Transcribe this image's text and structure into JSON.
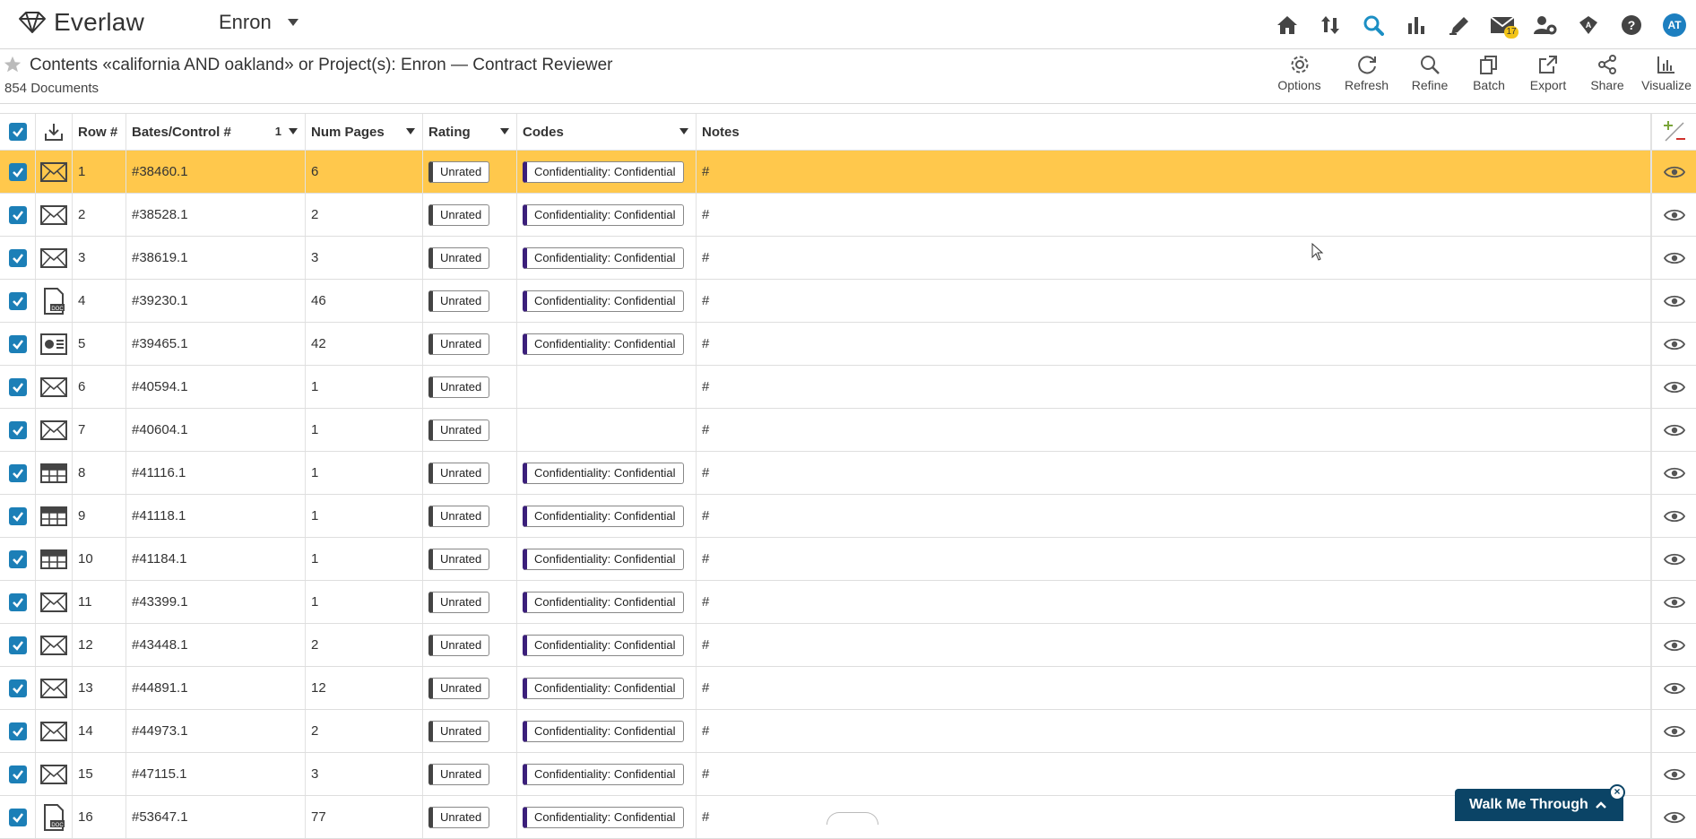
{
  "app": {
    "brand": "Everlaw",
    "project": "Enron"
  },
  "nav": {
    "notification_count": "17",
    "avatar_initials": "AT"
  },
  "search": {
    "title": "Contents «california AND oakland» or Project(s): Enron — Contract Reviewer",
    "doc_count": "854 Documents"
  },
  "actions": [
    "Options",
    "Refresh",
    "Refine",
    "Batch",
    "Export",
    "Share",
    "Visualize"
  ],
  "table": {
    "headers": {
      "row": "Row #",
      "bates": "Bates/Control #",
      "bates_sort": "1",
      "pages": "Num Pages",
      "rating": "Rating",
      "codes": "Codes",
      "notes": "Notes"
    },
    "rows": [
      {
        "row": "1",
        "type": "email-icon",
        "bates": "#38460.1",
        "pages": "6",
        "rating": "Unrated",
        "code": "Confidentiality: Confidential",
        "notes": "#",
        "selected": true
      },
      {
        "row": "2",
        "type": "email-icon",
        "bates": "#38528.1",
        "pages": "2",
        "rating": "Unrated",
        "code": "Confidentiality: Confidential",
        "notes": "#"
      },
      {
        "row": "3",
        "type": "email-icon",
        "bates": "#38619.1",
        "pages": "3",
        "rating": "Unrated",
        "code": "Confidentiality: Confidential",
        "notes": "#"
      },
      {
        "row": "4",
        "type": "doc-icon",
        "bates": "#39230.1",
        "pages": "46",
        "rating": "Unrated",
        "code": "Confidentiality: Confidential",
        "notes": "#"
      },
      {
        "row": "5",
        "type": "presentation-icon",
        "bates": "#39465.1",
        "pages": "42",
        "rating": "Unrated",
        "code": "Confidentiality: Confidential",
        "notes": "#"
      },
      {
        "row": "6",
        "type": "email-icon",
        "bates": "#40594.1",
        "pages": "1",
        "rating": "Unrated",
        "code": "",
        "notes": "#"
      },
      {
        "row": "7",
        "type": "email-icon",
        "bates": "#40604.1",
        "pages": "1",
        "rating": "Unrated",
        "code": "",
        "notes": "#"
      },
      {
        "row": "8",
        "type": "spreadsheet-icon",
        "bates": "#41116.1",
        "pages": "1",
        "rating": "Unrated",
        "code": "Confidentiality: Confidential",
        "notes": "#"
      },
      {
        "row": "9",
        "type": "spreadsheet-icon",
        "bates": "#41118.1",
        "pages": "1",
        "rating": "Unrated",
        "code": "Confidentiality: Confidential",
        "notes": "#"
      },
      {
        "row": "10",
        "type": "spreadsheet-icon",
        "bates": "#41184.1",
        "pages": "1",
        "rating": "Unrated",
        "code": "Confidentiality: Confidential",
        "notes": "#"
      },
      {
        "row": "11",
        "type": "email-icon",
        "bates": "#43399.1",
        "pages": "1",
        "rating": "Unrated",
        "code": "Confidentiality: Confidential",
        "notes": "#"
      },
      {
        "row": "12",
        "type": "email-icon",
        "bates": "#43448.1",
        "pages": "2",
        "rating": "Unrated",
        "code": "Confidentiality: Confidential",
        "notes": "#"
      },
      {
        "row": "13",
        "type": "email-icon",
        "bates": "#44891.1",
        "pages": "12",
        "rating": "Unrated",
        "code": "Confidentiality: Confidential",
        "notes": "#"
      },
      {
        "row": "14",
        "type": "email-icon",
        "bates": "#44973.1",
        "pages": "2",
        "rating": "Unrated",
        "code": "Confidentiality: Confidential",
        "notes": "#"
      },
      {
        "row": "15",
        "type": "email-icon",
        "bates": "#47115.1",
        "pages": "3",
        "rating": "Unrated",
        "code": "Confidentiality: Confidential",
        "notes": "#"
      },
      {
        "row": "16",
        "type": "doc-icon",
        "bates": "#53647.1",
        "pages": "77",
        "rating": "Unrated",
        "code": "Confidentiality: Confidential",
        "notes": "#"
      }
    ]
  },
  "walkme": {
    "label": "Walk Me Through",
    "close": "×"
  },
  "colors": {
    "accent": "#1c7fb7",
    "selected_row": "#ffc84c",
    "walkme": "#0b4466"
  }
}
